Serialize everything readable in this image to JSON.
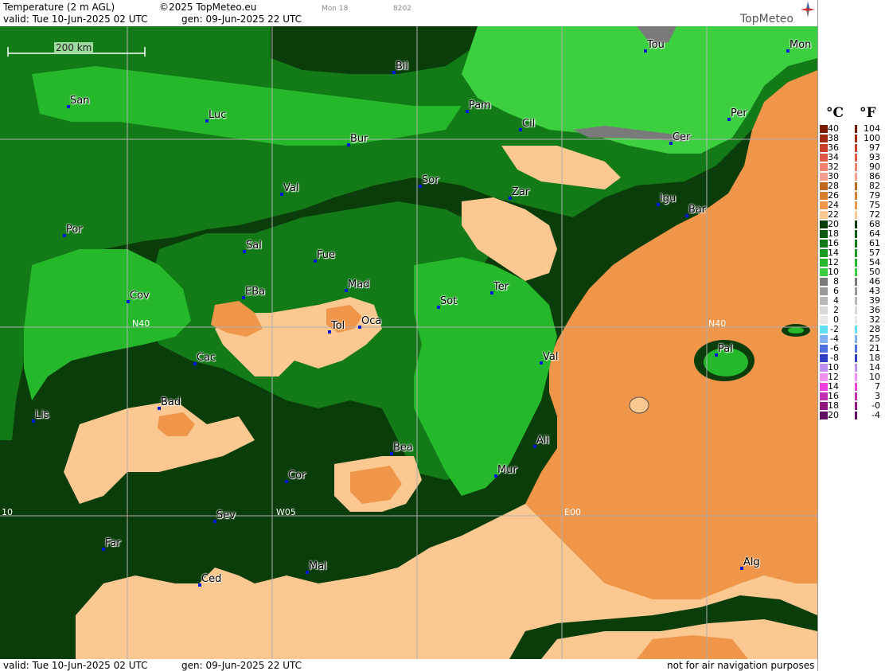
{
  "header": {
    "title": "Temperature (2 m AGL)",
    "copyright": "©2025 TopMeteo.eu",
    "weekday": "Mon 18",
    "code": "8202",
    "valid": "valid:  Tue  10-Jun-2025  02 UTC",
    "gen": "gen: 09-Jun-2025 22 UTC",
    "logo": "TopMeteo"
  },
  "footer": {
    "valid": "valid:  Tue  10-Jun-2025  02 UTC",
    "gen": "gen: 09-Jun-2025 22 UTC",
    "note": "not for air navigation purposes"
  },
  "scale_bar": "200 km",
  "grid_labels": {
    "lat": "N40",
    "lat_right": "N40",
    "lon_w10": "10",
    "lon_w05": "W05",
    "lon_e00": "E00"
  },
  "legend": {
    "celsius_unit": "°C",
    "fahrenheit_unit": "°F",
    "celsius": [
      "40",
      "38",
      "36",
      "34",
      "32",
      "30",
      "28",
      "26",
      "24",
      "22",
      "20",
      "18",
      "16",
      "14",
      "12",
      "10",
      "8",
      "6",
      "4",
      "2",
      "0",
      "-2",
      "-4",
      "-6",
      "-8",
      "-10",
      "-12",
      "-14",
      "-16",
      "-18",
      "-20"
    ],
    "fahrenheit": [
      "104",
      "100",
      "97",
      "93",
      "90",
      "86",
      "82",
      "79",
      "75",
      "72",
      "68",
      "64",
      "61",
      "57",
      "54",
      "50",
      "46",
      "43",
      "39",
      "36",
      "32",
      "28",
      "25",
      "21",
      "18",
      "14",
      "10",
      "7",
      "3",
      "-0",
      "-4"
    ],
    "colors": [
      "#7a1a00",
      "#a02a10",
      "#c8402a",
      "#e05a4a",
      "#f08070",
      "#f4a090",
      "#c06a20",
      "#d6802e",
      "#f0964a",
      "#fac890",
      "#0b3d0b",
      "#0f5a12",
      "#137a18",
      "#1a9a20",
      "#24b82a",
      "#3cd040",
      "#7a7a7a",
      "#999999",
      "#b8b8b8",
      "#d8d8d8",
      "#e8e8e8",
      "#60e0f0",
      "#80b0f0",
      "#5070e0",
      "#3040c0",
      "#c090f0",
      "#f090f0",
      "#f040e0",
      "#c030b0",
      "#901880",
      "#601060"
    ]
  },
  "cities": [
    {
      "name": "San"
    },
    {
      "name": "Luc"
    },
    {
      "name": "Bil"
    },
    {
      "name": "Tou"
    },
    {
      "name": "Mon"
    },
    {
      "name": "Pam"
    },
    {
      "name": "Cil"
    },
    {
      "name": "Per"
    },
    {
      "name": "Bur"
    },
    {
      "name": "Cer"
    },
    {
      "name": "Sor"
    },
    {
      "name": "Zar"
    },
    {
      "name": "Val"
    },
    {
      "name": "Igu"
    },
    {
      "name": "Bar"
    },
    {
      "name": "Por"
    },
    {
      "name": "Sal"
    },
    {
      "name": "Fue"
    },
    {
      "name": "Mad"
    },
    {
      "name": "EBa"
    },
    {
      "name": "Cov"
    },
    {
      "name": "Ter"
    },
    {
      "name": "Sot"
    },
    {
      "name": "Tol"
    },
    {
      "name": "Oca"
    },
    {
      "name": "Cac"
    },
    {
      "name": "Val"
    },
    {
      "name": "Pal"
    },
    {
      "name": "Bad"
    },
    {
      "name": "Lis"
    },
    {
      "name": "Bea"
    },
    {
      "name": "Ali"
    },
    {
      "name": "Cor"
    },
    {
      "name": "Mur"
    },
    {
      "name": "Sev"
    },
    {
      "name": "Far"
    },
    {
      "name": "Mal"
    },
    {
      "name": "Ced"
    },
    {
      "name": "Alg"
    }
  ],
  "colors": {
    "dark_green": "#0b3d0b",
    "green": "#137a18",
    "light_green": "#3cd040",
    "peach": "#fac890",
    "orange": "#f0964a",
    "city_dot": "#0018d8"
  }
}
